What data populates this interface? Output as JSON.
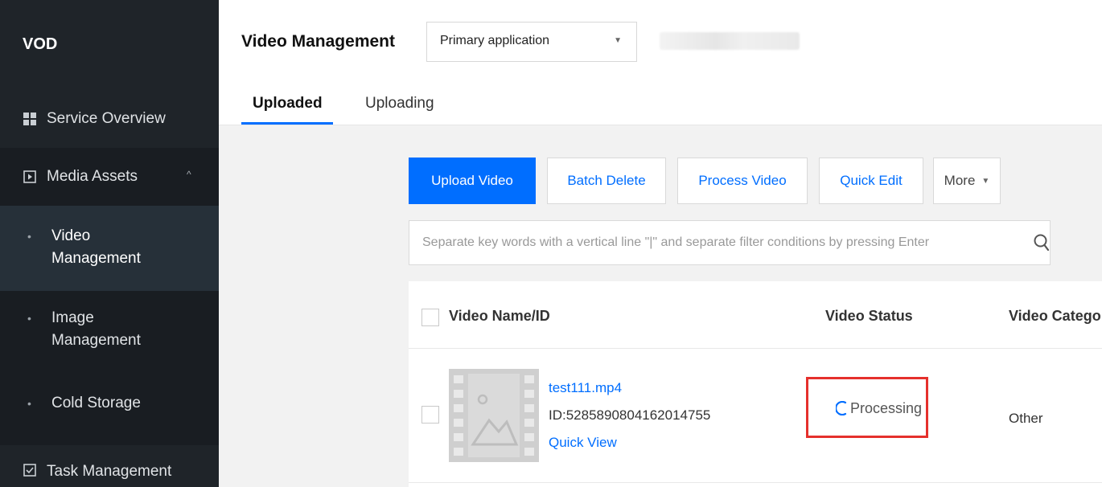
{
  "sidebar": {
    "brand": "VOD",
    "service_overview": "Service Overview",
    "media_assets": "Media Assets",
    "video_management": "Video Management",
    "image_management": "Image Management",
    "cold_storage": "Cold Storage",
    "task_management": "Task Management"
  },
  "header": {
    "title": "Video Management",
    "app_select_value": "Primary application",
    "tabs": [
      {
        "label": "Uploaded",
        "active": true
      },
      {
        "label": "Uploading",
        "active": false
      }
    ]
  },
  "toolbar": {
    "upload_label": "Upload Video",
    "batch_delete_label": "Batch Delete",
    "process_label": "Process Video",
    "quick_edit_label": "Quick Edit",
    "more_label": "More"
  },
  "search": {
    "placeholder": "Separate key words with a vertical line \"|\" and separate filter conditions by pressing Enter"
  },
  "table": {
    "columns": [
      "Video Name/ID",
      "Video Status",
      "Video Catego"
    ],
    "rows": [
      {
        "name": "test111.mp4",
        "id": "ID:5285890804162014755",
        "quick_view": "Quick View",
        "status": "Processing",
        "category": "Other"
      }
    ]
  },
  "colors": {
    "accent": "#006eff",
    "highlight": "#e5302c",
    "sidebar_bg": "#1f2429"
  },
  "icons": {
    "service_overview": "grid-icon",
    "media_assets": "play-square-icon",
    "task_management": "checkbox-icon",
    "search": "search-icon",
    "status": "spinner-icon",
    "thumbnail": "video-placeholder-icon"
  }
}
